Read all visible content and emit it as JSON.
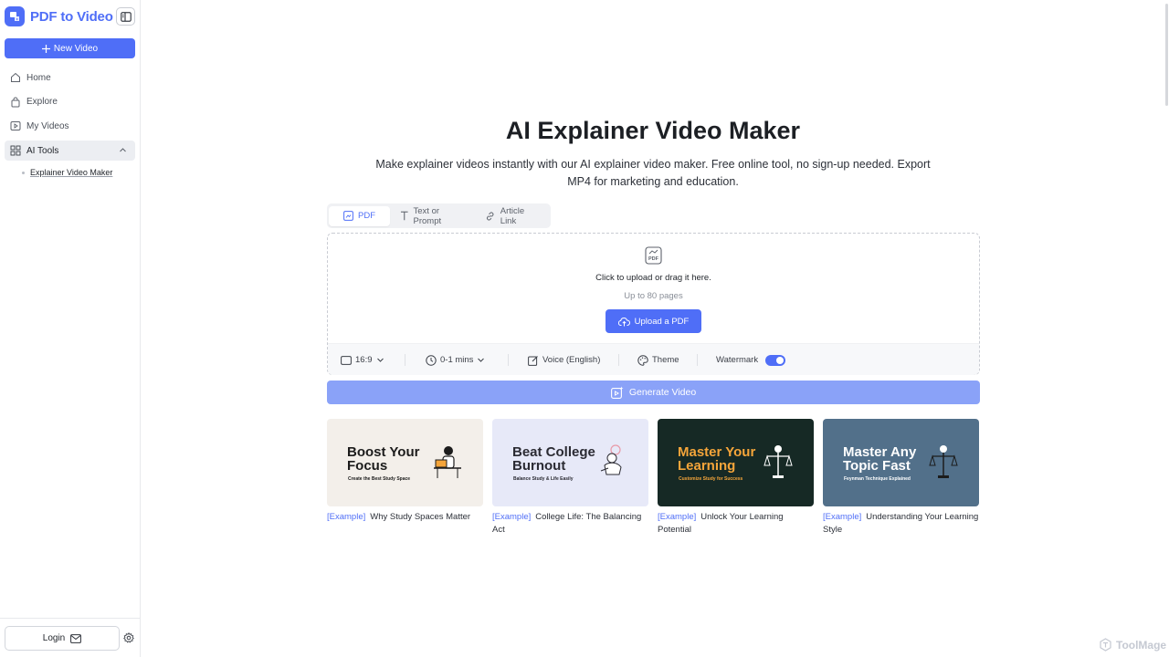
{
  "app": {
    "name": "PDF to Video",
    "brand_color": "#4f6ef7"
  },
  "sidebar": {
    "new_video_label": "New Video",
    "items": [
      {
        "label": "Home",
        "icon": "home-icon"
      },
      {
        "label": "Explore",
        "icon": "bag-icon"
      },
      {
        "label": "My Videos",
        "icon": "video-icon"
      },
      {
        "label": "AI Tools",
        "icon": "grid-icon"
      }
    ],
    "sub_items": [
      {
        "label": "Explainer Video Maker"
      }
    ],
    "login_label": "Login"
  },
  "hero": {
    "title": "AI Explainer Video Maker",
    "subtitle": "Make explainer videos instantly with our AI explainer video maker. Free online tool, no sign-up needed. Export MP4 for marketing and education."
  },
  "tabs": [
    {
      "label": "PDF",
      "active": true
    },
    {
      "label": "Text or Prompt",
      "active": false
    },
    {
      "label": "Article Link",
      "active": false
    }
  ],
  "upload": {
    "hint": "Click to upload or drag it here.",
    "limit": "Up to 80 pages",
    "button_label": "Upload a PDF"
  },
  "options": {
    "aspect_ratio": "16:9",
    "duration": "0-1 mins",
    "voice": "Voice (English)",
    "theme": "Theme",
    "watermark_label": "Watermark",
    "watermark_on": true
  },
  "generate_label": "Generate Video",
  "examples": [
    {
      "tag": "[Example]",
      "caption": "Why Study Spaces Matter",
      "thumb_title": "Boost Your Focus",
      "thumb_sub": "Create the Best Study Space",
      "bg": "#f3efea",
      "title_color": "#1c1c1c",
      "sub_color": "#1c1c1c"
    },
    {
      "tag": "[Example]",
      "caption": "College Life: The Balancing Act",
      "thumb_title": "Beat College Burnout",
      "thumb_sub": "Balance Study & Life Easily",
      "bg": "#e7e9f8",
      "title_color": "#2b2b33",
      "sub_color": "#2b2b33"
    },
    {
      "tag": "[Example]",
      "caption": "Unlock Your Learning Potential",
      "thumb_title": "Master Your Learning",
      "thumb_sub": "Customize Study for Success",
      "bg": "#162925",
      "title_color": "#f5a53a",
      "sub_color": "#f5a53a"
    },
    {
      "tag": "[Example]",
      "caption": "Understanding Your Learning Style",
      "thumb_title": "Master Any Topic Fast",
      "thumb_sub": "Feynman Technique Explained",
      "bg": "#52708a",
      "title_color": "#ffffff",
      "sub_color": "#ffffff"
    }
  ],
  "watermark_brand": "ToolMage"
}
